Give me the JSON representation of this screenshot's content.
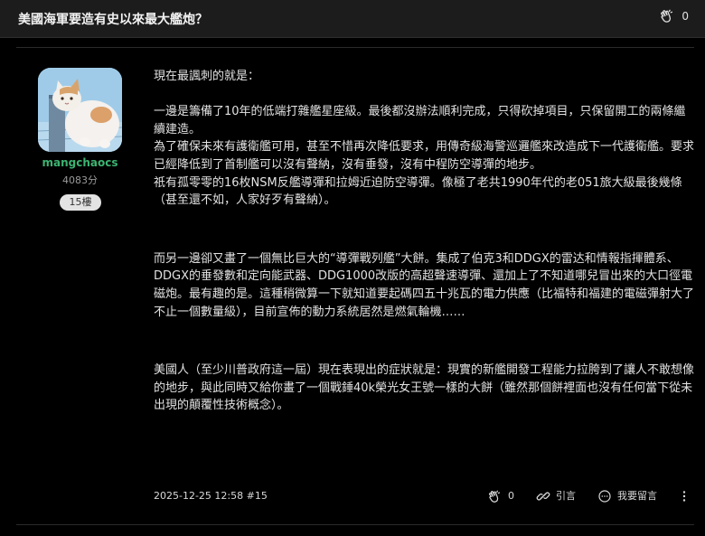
{
  "thread": {
    "title": "美國海軍要造有史以來最大艦炮？",
    "gp_count": "0"
  },
  "author": {
    "username": "mangchaocs",
    "score": "4083分",
    "floor": "15樓"
  },
  "post": {
    "paragraphs": [
      "現在最諷刺的就是：",
      "一邊是籌備了10年的低端打雜艦星座級。最後都沒辦法順利完成，只得砍掉項目，只保留開工的兩條繼續建造。",
      "為了確保未來有護衛艦可用，甚至不惜再次降低要求，用傳奇級海警巡邏艦來改造成下一代護衛艦。要求已經降低到了首制艦可以沒有聲納，沒有垂發，沒有中程防空導彈的地步。",
      "祇有孤零零的16枚NSM反艦導彈和拉姆近迫防空導彈。像極了老共1990年代的老051旅大級最後幾條（甚至還不如，人家好歹有聲納）。",
      "而另一邊卻又畫了一個無比巨大的“導彈戰列艦”大餅。集成了伯克3和DDGX的雷达和情報指揮體系、DDGX的垂發數和定向能武器、DDG1000改版的高超聲速導彈、還加上了不知道哪兒冒出來的大口徑電磁炮。最有趣的是。這種稍微算一下就知道要起碼四五十兆瓦的電力供應（比福特和福建的電磁彈射大了不止一個數量級），目前宣佈的動力系統居然是燃氣輪機……",
      "美國人（至少川普政府這一屆）現在表現出的症狀就是：現實的新艦開發工程能力拉胯到了讓人不敢想像的地步，與此同時又給你畫了一個戰錘40k榮光女王號一樣的大餅（雖然那個餅裡面也沒有任何當下從未出現的顛覆性技術概念）。"
    ],
    "timestamp": "2025-12-25 12:58",
    "floor_ref": "#15",
    "gp_count": "0",
    "quote_label": "引言",
    "reply_label": "我要留言"
  },
  "icons": {
    "gp": "clap-hand-icon",
    "quote": "quote-link-icon",
    "reply": "comment-bubble-icon",
    "more": "more-vertical-icon"
  },
  "colors": {
    "background": "#000000",
    "topbar": "#1c1c1c",
    "username": "#3cb371",
    "text": "#e2e2e2"
  }
}
